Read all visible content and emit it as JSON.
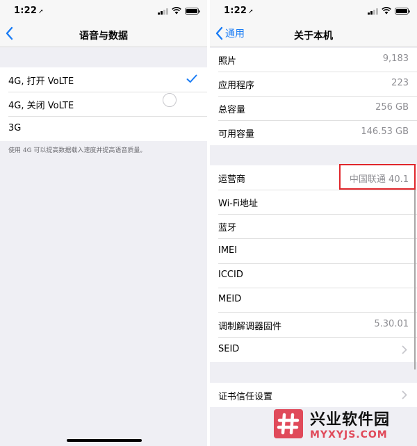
{
  "left": {
    "status": {
      "time": "1:22",
      "location_glyph": "➚"
    },
    "nav": {
      "title": "语音与数据"
    },
    "options": [
      {
        "label": "4G, 打开 VoLTE",
        "selected": true
      },
      {
        "label": "4G, 关闭 VoLTE",
        "selected": false
      },
      {
        "label": "3G",
        "selected": false
      }
    ],
    "footnote": "使用 4G 可以提高数据载入速度并提高语音质量。"
  },
  "right": {
    "status": {
      "time": "1:22",
      "location_glyph": "➚"
    },
    "nav": {
      "back_label": "通用",
      "title": "关于本机"
    },
    "group1": [
      {
        "label": "照片",
        "value": "9,183"
      },
      {
        "label": "应用程序",
        "value": "223"
      },
      {
        "label": "总容量",
        "value": "256 GB"
      },
      {
        "label": "可用容量",
        "value": "146.53 GB"
      }
    ],
    "group2": [
      {
        "label": "运营商",
        "value": "中国联通 40.1"
      },
      {
        "label": "Wi-Fi地址",
        "value": ""
      },
      {
        "label": "蓝牙",
        "value": ""
      },
      {
        "label": "IMEI",
        "value": ""
      },
      {
        "label": "ICCID",
        "value": ""
      },
      {
        "label": "MEID",
        "value": ""
      },
      {
        "label": "调制解调器固件",
        "value": "5.30.01"
      },
      {
        "label": "SEID",
        "value": ""
      }
    ],
    "group3": [
      {
        "label": "证书信任设置"
      }
    ]
  },
  "watermark": {
    "main": "兴业软件园",
    "sub": "MYXYJS.COM"
  },
  "colors": {
    "accent": "#1a7cf5",
    "highlight": "#e0262b",
    "watermark_red": "#e04a5a"
  }
}
